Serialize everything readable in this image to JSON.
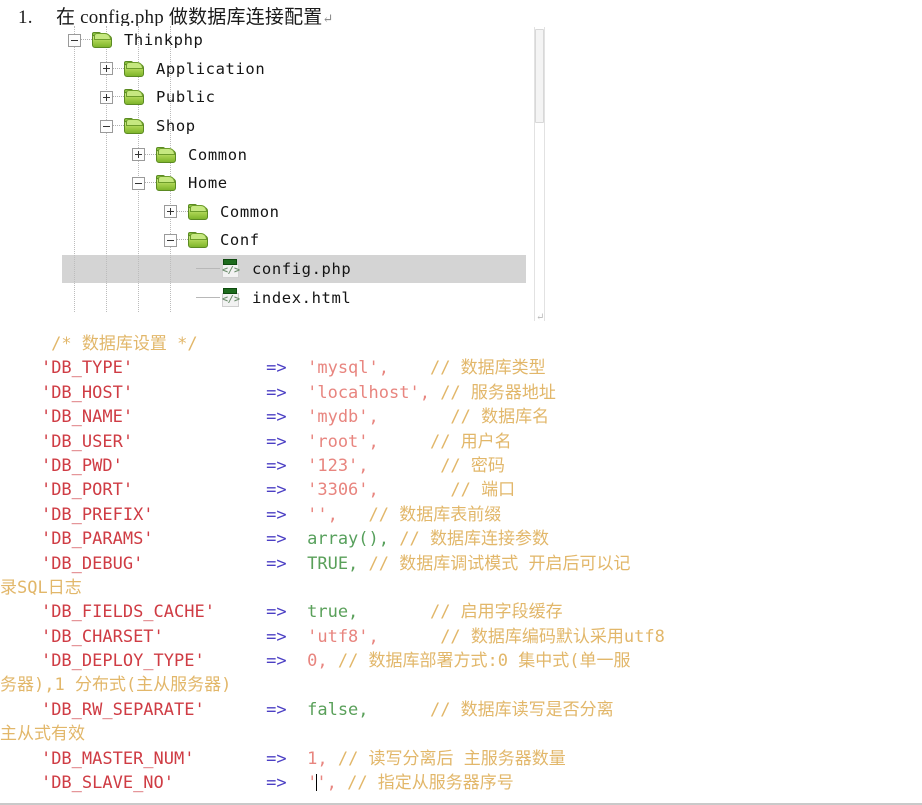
{
  "document": {
    "title_number": "1.",
    "title_text": "在 config.php 做数据库连接配置",
    "pilcrow": "↵"
  },
  "file_tree": {
    "scroll_end_mark": "↵",
    "nodes": [
      {
        "label": "Thinkphp",
        "depth": 0,
        "type": "folder",
        "expander": "minus",
        "selected": false
      },
      {
        "label": "Application",
        "depth": 1,
        "type": "folder",
        "expander": "plus",
        "selected": false
      },
      {
        "label": "Public",
        "depth": 1,
        "type": "folder",
        "expander": "plus",
        "selected": false
      },
      {
        "label": "Shop",
        "depth": 1,
        "type": "folder",
        "expander": "minus",
        "selected": false
      },
      {
        "label": "Common",
        "depth": 2,
        "type": "folder",
        "expander": "plus",
        "selected": false
      },
      {
        "label": "Home",
        "depth": 2,
        "type": "folder",
        "expander": "minus",
        "selected": false
      },
      {
        "label": "Common",
        "depth": 3,
        "type": "folder",
        "expander": "plus",
        "selected": false
      },
      {
        "label": "Conf",
        "depth": 3,
        "type": "folder",
        "expander": "minus",
        "selected": false
      },
      {
        "label": "config.php",
        "depth": 4,
        "type": "file",
        "expander": "none",
        "selected": true
      },
      {
        "label": "index.html",
        "depth": 4,
        "type": "file",
        "expander": "none",
        "selected": false
      }
    ],
    "file_glyph": "</>"
  },
  "code": {
    "section_comment": "/* 数据库设置 */",
    "arrow": "=>",
    "lines": [
      {
        "key": "'DB_TYPE'",
        "gap1": "             ",
        "value": "'mysql',",
        "gap2": "    ",
        "comment": "// 数据库类型",
        "value_kind": "str"
      },
      {
        "key": "'DB_HOST'",
        "gap1": "             ",
        "value": "'localhost',",
        "gap2": " ",
        "comment": "// 服务器地址",
        "value_kind": "str"
      },
      {
        "key": "'DB_NAME'",
        "gap1": "             ",
        "value": "'mydb',",
        "gap2": "       ",
        "comment": "// 数据库名",
        "value_kind": "str"
      },
      {
        "key": "'DB_USER'",
        "gap1": "             ",
        "value": "'root',",
        "gap2": "     ",
        "comment": "// 用户名",
        "value_kind": "str"
      },
      {
        "key": "'DB_PWD'",
        "gap1": "              ",
        "value": "'123',",
        "gap2": "       ",
        "comment": "// 密码",
        "value_kind": "str"
      },
      {
        "key": "'DB_PORT'",
        "gap1": "             ",
        "value": "'3306',",
        "gap2": "       ",
        "comment": "// 端口",
        "value_kind": "str"
      },
      {
        "key": "'DB_PREFIX'",
        "gap1": "           ",
        "value": "'',",
        "gap2": "   ",
        "comment": "// 数据库表前缀",
        "value_kind": "str"
      },
      {
        "key": "'DB_PARAMS'",
        "gap1": "           ",
        "value": "array(),",
        "gap2": " ",
        "comment": "// 数据库连接参数",
        "value_kind": "fn"
      },
      {
        "key": "'DB_DEBUG'",
        "gap1": "            ",
        "value": "TRUE,",
        "gap2": " ",
        "comment": "// 数据库调试模式 开启后可以记",
        "value_kind": "const",
        "wrap": "录SQL日志"
      },
      {
        "key": "'DB_FIELDS_CACHE'",
        "gap1": "     ",
        "value": "true,",
        "gap2": "       ",
        "comment": "// 启用字段缓存",
        "value_kind": "const"
      },
      {
        "key": "'DB_CHARSET'",
        "gap1": "          ",
        "value": "'utf8',",
        "gap2": "      ",
        "comment": "// 数据库编码默认采用utf8",
        "value_kind": "str"
      },
      {
        "key": "'DB_DEPLOY_TYPE'",
        "gap1": "      ",
        "value": "0,",
        "gap2": " ",
        "comment": "// 数据库部署方式:0 集中式(单一服",
        "value_kind": "num",
        "wrap": "务器),1 分布式(主从服务器)"
      },
      {
        "key": "'DB_RW_SEPARATE'",
        "gap1": "      ",
        "value": "false,",
        "gap2": "      ",
        "comment": "// 数据库读写是否分离",
        "value_kind": "const",
        "wrap": "主从式有效"
      },
      {
        "key": "'DB_MASTER_NUM'",
        "gap1": "       ",
        "value": "1,",
        "gap2": " ",
        "comment": "// 读写分离后 主服务器数量",
        "value_kind": "num"
      },
      {
        "key": "'DB_SLAVE_NO'",
        "gap1": "         ",
        "value": "'',",
        "gap2": " ",
        "comment": "// 指定从服务器序号",
        "value_kind": "str",
        "caret_in_value": true
      }
    ]
  }
}
